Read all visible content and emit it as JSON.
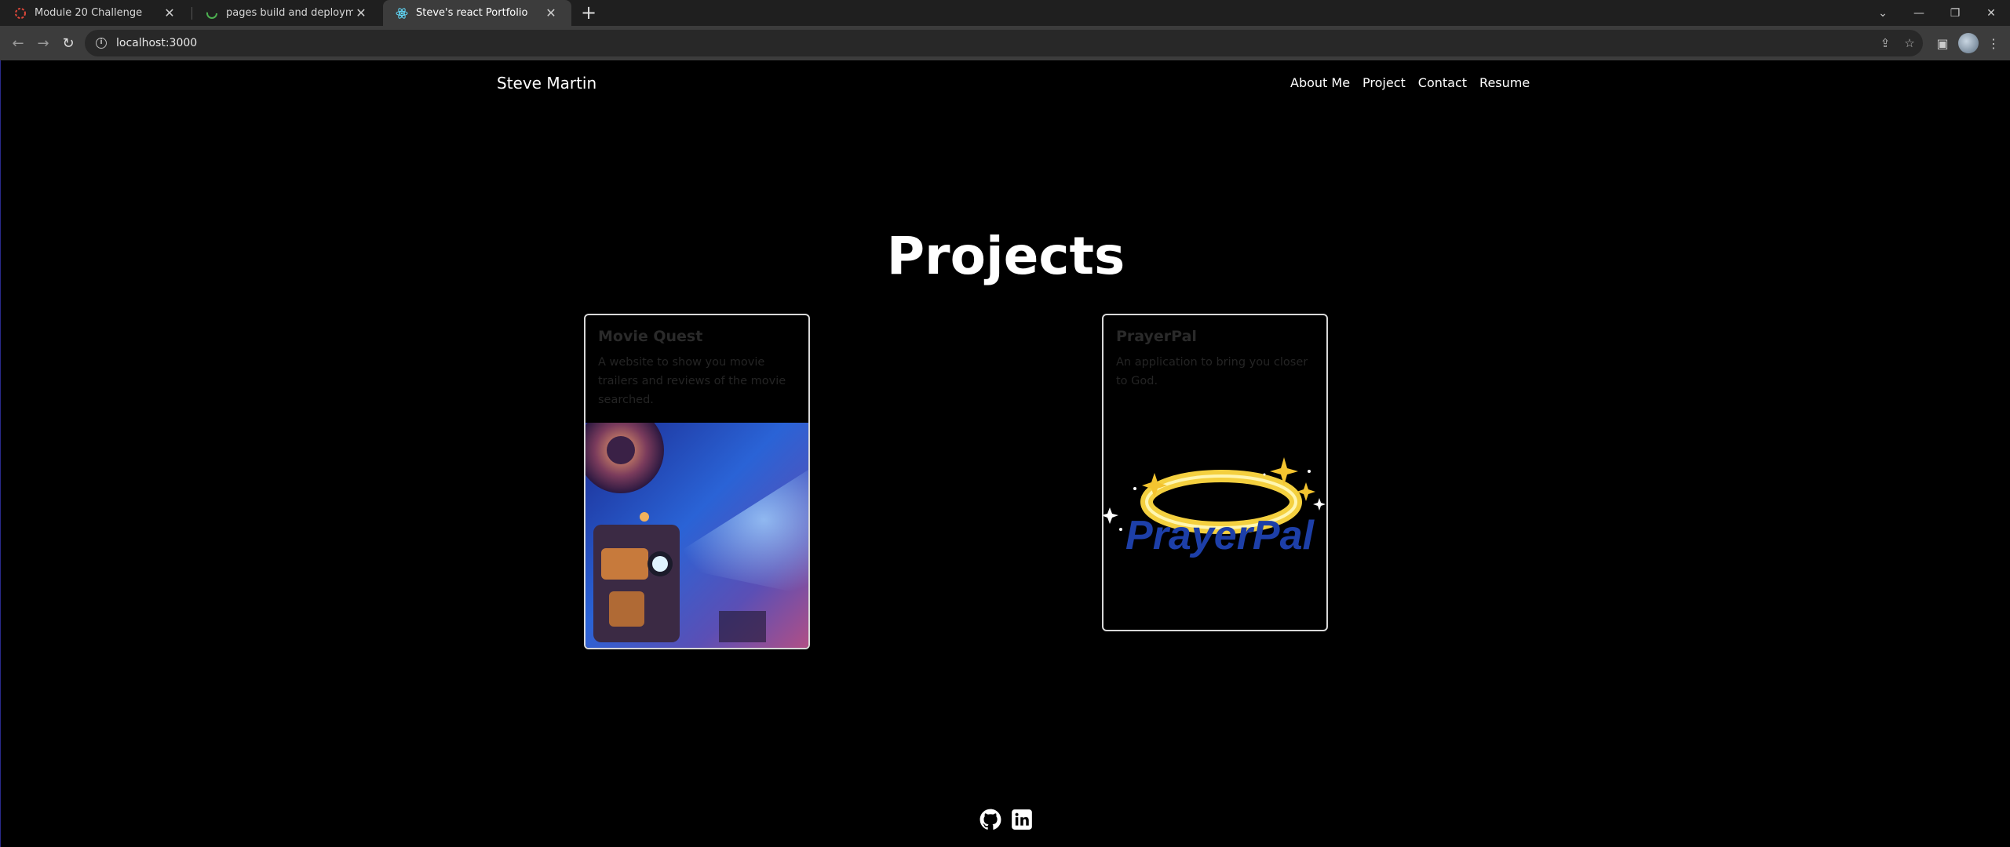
{
  "browser": {
    "tabs": [
      {
        "label": "Module 20 Challenge"
      },
      {
        "label": "pages build and deployment · W"
      },
      {
        "label": "Steve's react Portfolio"
      }
    ],
    "new_tab": "+",
    "url": "localhost:3000"
  },
  "site": {
    "brand": "Steve Martin",
    "nav": [
      "About Me",
      "Project",
      "Contact",
      "Resume"
    ]
  },
  "projects": {
    "heading": "Projects",
    "items": [
      {
        "title": "Movie Quest",
        "description": "A website to show you movie trailers and reviews of the movie searched."
      },
      {
        "title": "PrayerPal",
        "description": "An application to bring you closer to God.",
        "logo_text": "PrayerPal"
      }
    ]
  },
  "footer": {
    "icons": [
      "github-icon",
      "linkedin-icon"
    ]
  },
  "colors": {
    "page_bg": "#000000",
    "chrome_bg": "#1f1f1f",
    "toolbar_bg": "#3c3c3c",
    "prayerpal_blue": "#1d3fa8",
    "halo_gold": "#f4d03f"
  }
}
